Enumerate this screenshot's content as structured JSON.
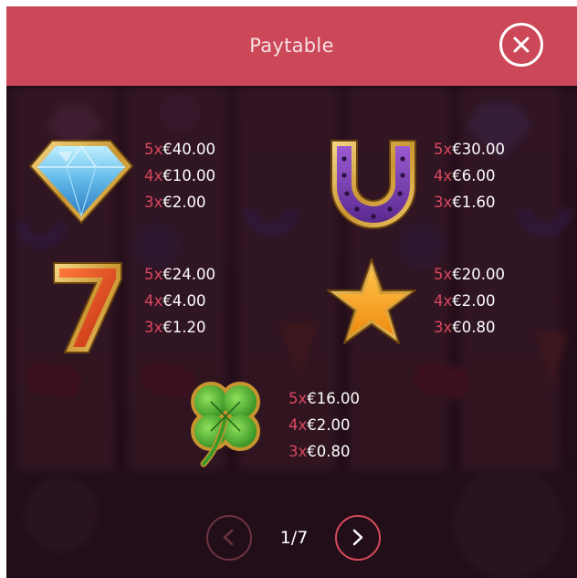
{
  "header": {
    "title": "Paytable",
    "close_icon": "close-x-icon"
  },
  "colors": {
    "header_bg": "#cc4757",
    "multiplier_text": "#d8475d",
    "amount_text": "#ffffff",
    "nav_active": "#d64a5c",
    "nav_disabled": "#6c3440"
  },
  "symbols": [
    {
      "name": "diamond",
      "icon": "diamond-icon",
      "payouts": [
        {
          "multiplier": "5x",
          "amount": "€40.00"
        },
        {
          "multiplier": "4x",
          "amount": "€10.00"
        },
        {
          "multiplier": "3x",
          "amount": "€2.00"
        }
      ]
    },
    {
      "name": "horseshoe",
      "icon": "horseshoe-icon",
      "payouts": [
        {
          "multiplier": "5x",
          "amount": "€30.00"
        },
        {
          "multiplier": "4x",
          "amount": "€6.00"
        },
        {
          "multiplier": "3x",
          "amount": "€1.60"
        }
      ]
    },
    {
      "name": "seven",
      "icon": "seven-icon",
      "payouts": [
        {
          "multiplier": "5x",
          "amount": "€24.00"
        },
        {
          "multiplier": "4x",
          "amount": "€4.00"
        },
        {
          "multiplier": "3x",
          "amount": "€1.20"
        }
      ]
    },
    {
      "name": "star",
      "icon": "star-icon",
      "payouts": [
        {
          "multiplier": "5x",
          "amount": "€20.00"
        },
        {
          "multiplier": "4x",
          "amount": "€2.00"
        },
        {
          "multiplier": "3x",
          "amount": "€0.80"
        }
      ]
    },
    {
      "name": "clover",
      "icon": "four-leaf-clover-icon",
      "payouts": [
        {
          "multiplier": "5x",
          "amount": "€16.00"
        },
        {
          "multiplier": "4x",
          "amount": "€2.00"
        },
        {
          "multiplier": "3x",
          "amount": "€0.80"
        }
      ]
    }
  ],
  "pagination": {
    "current": 1,
    "total": 7,
    "label": "1/7",
    "prev_icon": "chevron-left-icon",
    "next_icon": "chevron-right-icon",
    "prev_enabled": false,
    "next_enabled": true
  }
}
